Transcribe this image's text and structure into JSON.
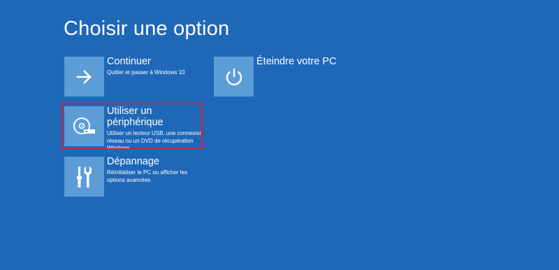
{
  "page": {
    "title": "Choisir une option",
    "background": "#1f68b8",
    "tile_color": "#5c9dd8",
    "highlight_color": "#e11a2d"
  },
  "options": [
    {
      "title": "Continuer",
      "description": "Quitter et passer à Windows 10",
      "icon": "arrow-right-icon"
    },
    {
      "title": "Éteindre votre PC",
      "description": "",
      "icon": "power-icon"
    },
    {
      "title": "Utiliser un périphérique",
      "description": "Utiliser un lecteur USB, une connexion réseau ou un DVD de récupération Windows",
      "icon": "disc-drive-icon",
      "highlighted": true
    },
    {
      "title": "Dépannage",
      "description": "Réinitialiser le PC ou afficher les options avancées",
      "icon": "tools-icon"
    }
  ]
}
